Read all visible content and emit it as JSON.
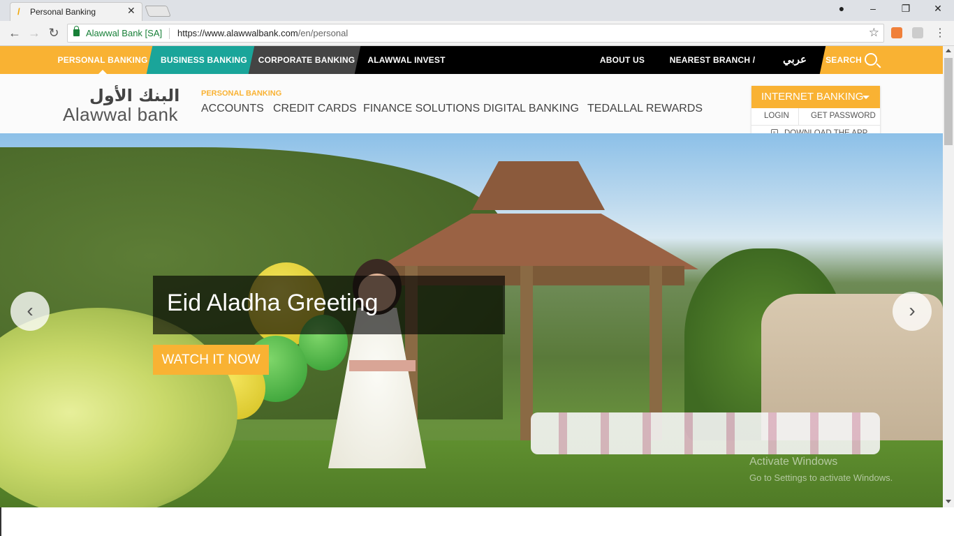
{
  "browser": {
    "tab_title": "Personal Banking",
    "tab_close": "✕",
    "secure_label": "Alawwal Bank [SA]",
    "url_host": "https://www.alawwalbank.com",
    "url_path": "/en/personal"
  },
  "topbar": {
    "personal": "PERSONAL BANKING",
    "business": "BUSINESS BANKING",
    "corporate": "CORPORATE BANKING",
    "invest": "ALAWWAL INVEST",
    "about": "ABOUT US",
    "branch": "NEAREST BRANCH / ATM",
    "arabic": "عربي",
    "search": "SEARCH"
  },
  "header": {
    "logo_ar": "البنك الأول",
    "logo_en": "Alawwal bank",
    "section": "PERSONAL BANKING",
    "nav": [
      "ACCOUNTS",
      "CREDIT CARDS",
      "FINANCE SOLUTIONS",
      "DIGITAL BANKING",
      "TEDALLAL REWARDS"
    ]
  },
  "internet_banking": {
    "label": "INTERNET BANKING",
    "login": "LOGIN",
    "get_password": "GET PASSWORD",
    "download_app": "DOWNLOAD THE APP"
  },
  "hero": {
    "caption": "Eid Aladha Greeting",
    "cta": "WATCH IT NOW",
    "prev": "‹",
    "next": "›"
  },
  "watermark": {
    "line1": "Activate Windows",
    "line2": "Go to Settings to activate Windows."
  },
  "colors": {
    "brand_yellow": "#f9b233",
    "business_teal": "#1aa59a",
    "corporate_gray": "#444444",
    "invest_black": "#000000"
  }
}
